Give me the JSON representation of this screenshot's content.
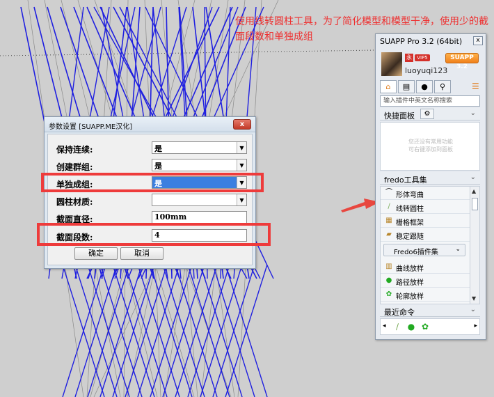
{
  "annotation": "使用线转圆柱工具，为了简化模型和模型干净，使用少的截面段数和单独成组",
  "dialog": {
    "title": "参数设置 [SUAPP.ME汉化]",
    "close_label": "x",
    "fields": [
      {
        "label": "保持连续:",
        "value": "是",
        "type": "select"
      },
      {
        "label": "创建群组:",
        "value": "是",
        "type": "select"
      },
      {
        "label": "单独成组:",
        "value": "是",
        "type": "select"
      },
      {
        "label": "圆柱材质:",
        "value": "",
        "type": "select"
      },
      {
        "label": "截面直径:",
        "value": "100mm",
        "type": "text"
      },
      {
        "label": "截面段数:",
        "value": "4",
        "type": "text"
      }
    ],
    "ok_label": "确定",
    "cancel_label": "取消"
  },
  "panel": {
    "title": "SUAPP Pro 3.2 (64bit)",
    "close_label": "x",
    "badge_1": "永",
    "badge_2": "VIP5",
    "pro_badge": "SUAPP 3.2",
    "username": "luoyuqi123",
    "search_placeholder": "输入插件中英文名称搜索",
    "quick_panel_label": "快捷面板",
    "quick_hint": "您还没有常用功能\n可右键添加到面板",
    "fredo_label": "fredo工具集",
    "tools": [
      {
        "label": "形体弯曲",
        "icon": "bend-icon"
      },
      {
        "label": "线转圆柱",
        "icon": "line-to-tube-icon"
      },
      {
        "label": "栅格框架",
        "icon": "grid-frame-icon"
      },
      {
        "label": "稳定跟随",
        "icon": "follow-icon"
      }
    ],
    "subgroup_label": "Fredo6插件集",
    "tools2": [
      {
        "label": "曲线放样",
        "icon": "curve-loft-icon"
      },
      {
        "label": "路径放样",
        "icon": "path-loft-icon"
      },
      {
        "label": "轮廓放样",
        "icon": "profile-loft-icon"
      }
    ],
    "recent_label": "最近命令"
  },
  "colors": {
    "annotation": "#ee3030",
    "highlight": "#ee3b3b",
    "wire_blue": "#1f1fe0",
    "wire_gray": "#8a8a8a",
    "background": "#cfcfcf"
  }
}
